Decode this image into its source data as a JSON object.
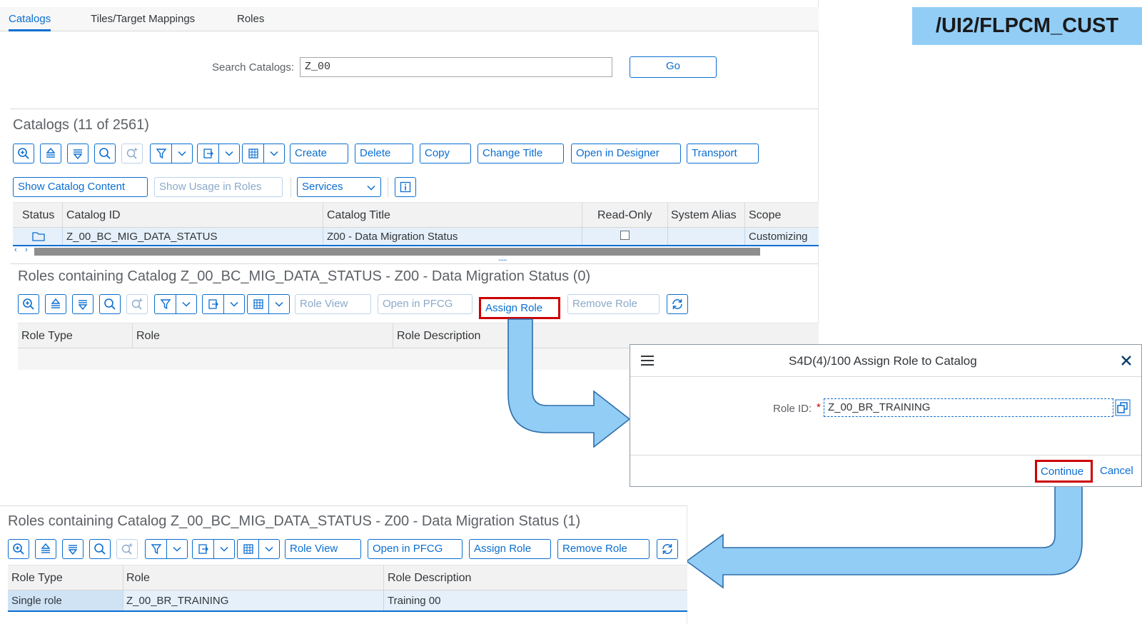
{
  "header_badge": "/UI2/FLPCM_CUST",
  "tabs": [
    {
      "label": "Catalogs"
    },
    {
      "label": "Tiles/Target Mappings"
    },
    {
      "label": "Roles"
    }
  ],
  "search": {
    "label": "Search Catalogs:",
    "value": "Z_00",
    "go_label": "Go"
  },
  "catalogs": {
    "title": "Catalogs (11 of 2561)",
    "toolbar": {
      "create": "Create",
      "delete": "Delete",
      "copy": "Copy",
      "change_title": "Change Title",
      "open_designer": "Open in Designer",
      "transport": "Transport"
    },
    "toolbar2": {
      "show_content": "Show Catalog Content",
      "show_usage": "Show Usage in Roles",
      "services": "Services"
    },
    "columns": [
      "Status",
      "Catalog ID",
      "Catalog Title",
      "Read-Only",
      "System Alias",
      "Scope"
    ],
    "row": {
      "status_icon": "folder-icon",
      "catalog_id": "Z_00_BC_MIG_DATA_STATUS",
      "catalog_title": "Z00 - Data Migration Status",
      "read_only": false,
      "system_alias": "",
      "scope": "Customizing"
    },
    "splitter": "....."
  },
  "roles_before": {
    "title": "Roles containing Catalog Z_00_BC_MIG_DATA_STATUS - Z00 - Data Migration Status (0)",
    "toolbar": {
      "role_view": "Role View",
      "open_pfcg": "Open in PFCG",
      "assign_role": "Assign Role",
      "remove_role": "Remove Role"
    },
    "columns": [
      "Role Type",
      "Role",
      "Role Description"
    ]
  },
  "dialog": {
    "title": "S4D(4)/100 Assign Role to Catalog",
    "role_label": "Role ID:",
    "required_mark": "*",
    "role_value": "Z_00_BR_TRAINING",
    "continue_label": "Continue",
    "cancel_label": "Cancel"
  },
  "roles_after": {
    "title": "Roles containing Catalog Z_00_BC_MIG_DATA_STATUS - Z00 - Data Migration Status (1)",
    "toolbar": {
      "role_view": "Role View",
      "open_pfcg": "Open in PFCG",
      "assign_role": "Assign Role",
      "remove_role": "Remove Role"
    },
    "columns": [
      "Role Type",
      "Role",
      "Role Description"
    ],
    "row": {
      "role_type": "Single role",
      "role": "Z_00_BR_TRAINING",
      "description": "Training 00"
    }
  },
  "colors": {
    "accent": "#0a6ed1",
    "highlight": "#cc0000",
    "badge_bg": "#92cdf6",
    "arrow_fill": "#92cdf6"
  }
}
